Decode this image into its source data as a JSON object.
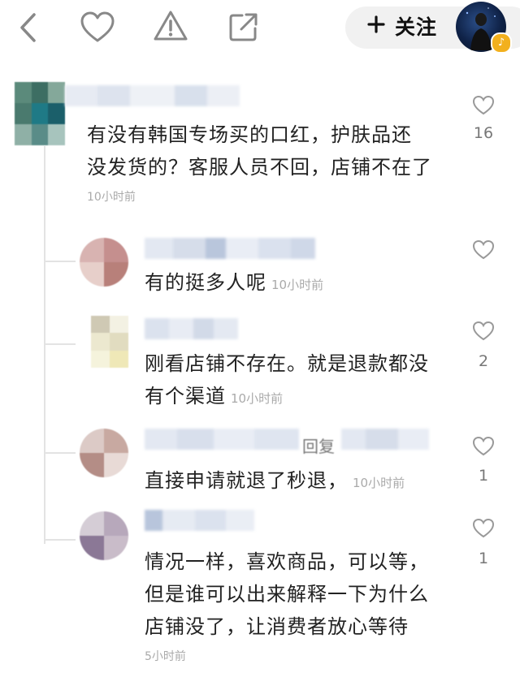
{
  "header": {
    "follow_label": "关注"
  },
  "comments": [
    {
      "text": "有没有韩国专场买的口红，护肤品还没发货的？客服人员不回，店铺不在了",
      "line1": "有没有韩国专场买的口红，护肤品还",
      "line2": "没发货的？客服人员不回，店铺不在了",
      "time": "10小时前",
      "likes": "16"
    }
  ],
  "replies": [
    {
      "text": "有的挺多人呢",
      "time": "10小时前",
      "likes": ""
    },
    {
      "line1": "刚看店铺不存在。就是退款都没",
      "line2": "有个渠道",
      "time": "10小时前",
      "likes": "2"
    },
    {
      "name_fragment": "回复",
      "text": "直接申请就退了秒退，",
      "time": "10小时前",
      "likes": "1"
    },
    {
      "line1": "情况一样，喜欢商品，可以等，",
      "line2": "但是谁可以出来解释一下为什么",
      "line3": "店铺没了，让消费者放心等待",
      "time": "5小时前",
      "likes": "1"
    }
  ],
  "colors": {
    "accent_badge": "#f2b01e",
    "follow_bg": "#f1f1f1"
  }
}
